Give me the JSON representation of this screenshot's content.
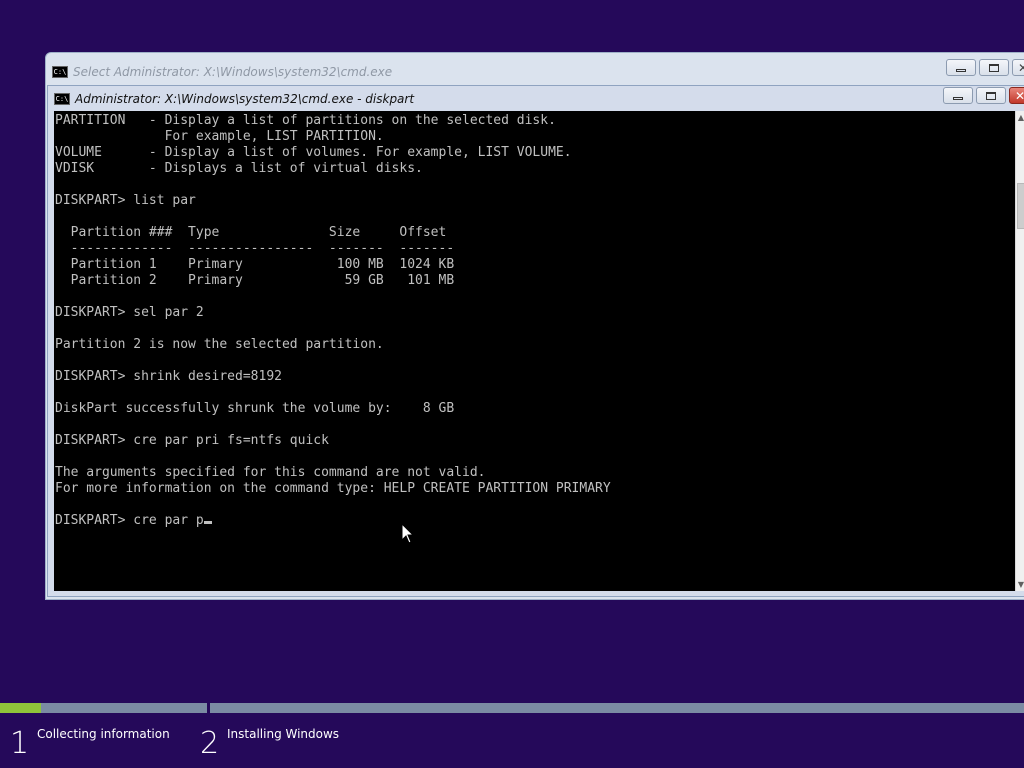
{
  "windows": {
    "back": {
      "title": "Select Administrator: X:\\Windows\\system32\\cmd.exe"
    },
    "front": {
      "title": "Administrator: X:\\Windows\\system32\\cmd.exe - diskpart"
    }
  },
  "window_controls": {
    "minimize": "",
    "maximize": "",
    "close": "✕"
  },
  "cmd_icon": "C:\\",
  "console": {
    "lines": [
      "PARTITION   - Display a list of partitions on the selected disk.",
      "              For example, LIST PARTITION.",
      "VOLUME      - Display a list of volumes. For example, LIST VOLUME.",
      "VDISK       - Displays a list of virtual disks.",
      "",
      "DISKPART> list par",
      "",
      "  Partition ###  Type              Size     Offset",
      "  -------------  ----------------  -------  -------",
      "  Partition 1    Primary            100 MB  1024 KB",
      "  Partition 2    Primary             59 GB   101 MB",
      "",
      "DISKPART> sel par 2",
      "",
      "Partition 2 is now the selected partition.",
      "",
      "DISKPART> shrink desired=8192",
      "",
      "DiskPart successfully shrunk the volume by:    8 GB",
      "",
      "DISKPART> cre par pri fs=ntfs quick",
      "",
      "The arguments specified for this command are not valid.",
      "For more information on the command type: HELP CREATE PARTITION PRIMARY",
      ""
    ],
    "prompt_input": "DISKPART> cre par p"
  },
  "setup_progress": {
    "steps": [
      {
        "number": "1",
        "label": "Collecting information",
        "progress": 0.2
      },
      {
        "number": "2",
        "label": "Installing Windows",
        "progress": 0
      }
    ]
  },
  "colors": {
    "desktop": "#25095a",
    "progress_fill": "#8fc43a",
    "progress_track": "#7b8ba3",
    "console_bg": "#000000",
    "console_text": "#c0c0c0"
  },
  "icons": {
    "window_icon": "cmd-icon",
    "pointer": "mouse-pointer-icon"
  }
}
